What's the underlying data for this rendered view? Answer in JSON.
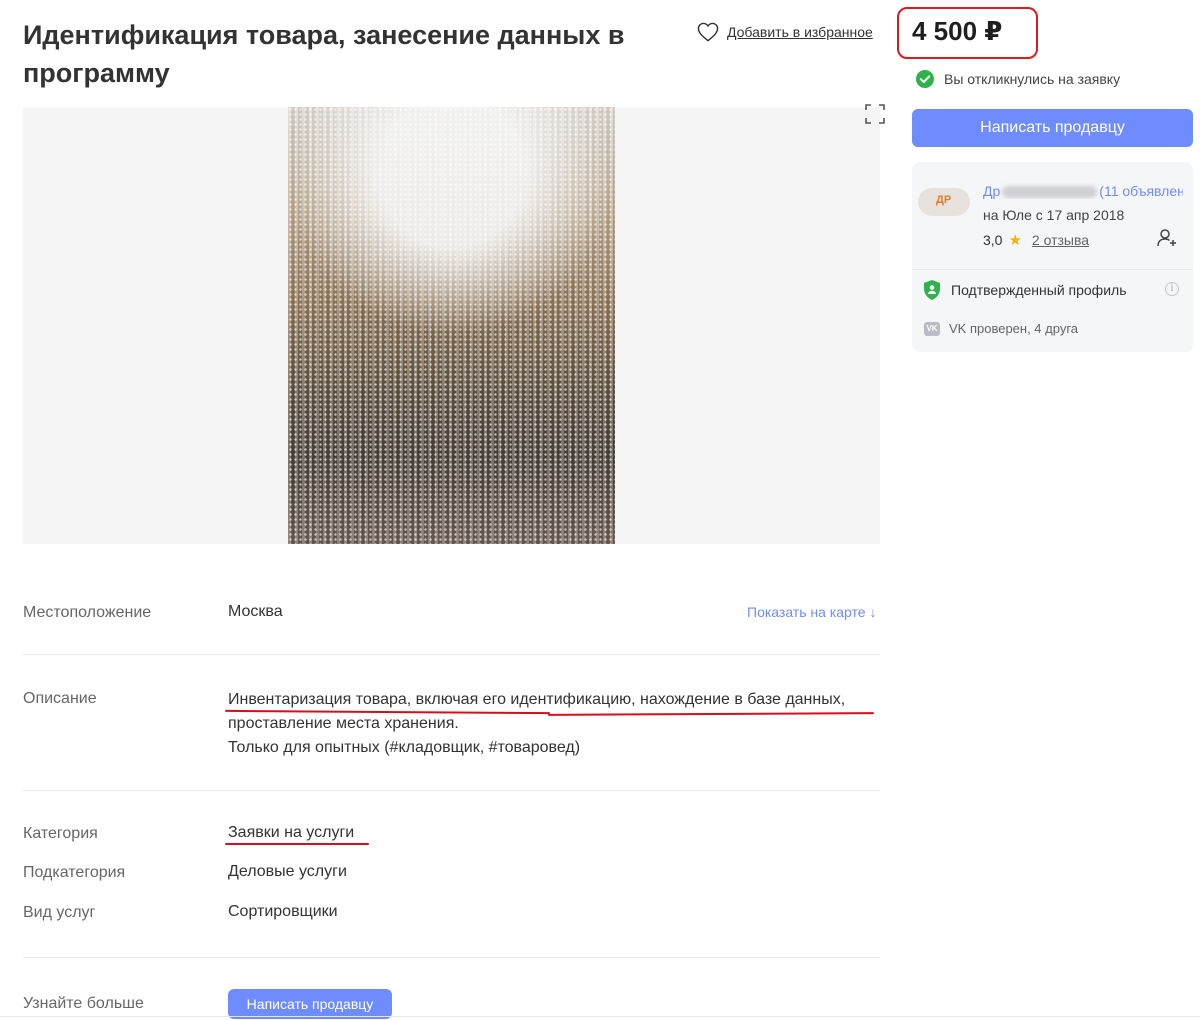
{
  "listing": {
    "title": "Идентификация товара, занесение данных в программу",
    "favorite_label": "Добавить в избранное",
    "price": "4 500 ₽",
    "responded_text": "Вы откликнулись на заявку",
    "contact_button": "Написать продавцу"
  },
  "seller": {
    "name_start": "Др",
    "name_end": "(11 объявлен...",
    "avatar_text": "ДР",
    "since": "на Юле с 17 апр 2018",
    "rating": "3,0",
    "reviews": "2 отзыва",
    "verified": "Подтвержденный профиль",
    "vk": "VK проверен, 4 друга",
    "vk_icon_text": "VK"
  },
  "details": {
    "location_label": "Местоположение",
    "location_value": "Москва",
    "map_link": "Показать на карте ↓",
    "description_label": "Описание",
    "description_line1": "Инвентаризация товара, включая его идентификацию, нахождение в базе данных,",
    "description_line2": "проставление места хранения.",
    "description_line3": "Только для опытных (#кладовщик, #товаровед)",
    "category_label": "Категория",
    "category_value": "Заявки на услуги",
    "subcategory_label": "Подкатегория",
    "subcategory_value": "Деловые услуги",
    "service_type_label": "Вид услуг",
    "service_type_value": "Сортировщики",
    "learn_more_label": "Узнайте больше",
    "learn_more_button": "Написать продавцу"
  },
  "icons": [
    "heart-icon",
    "check-circle-icon",
    "star-icon",
    "subscribe-icon",
    "shield-check-icon",
    "info-icon",
    "vk-icon",
    "expand-icon"
  ],
  "colors": {
    "accent": "#6f8cff",
    "annotation_red": "#d3101a",
    "success_green": "#2fb24c",
    "rating_star": "#f5b300"
  }
}
